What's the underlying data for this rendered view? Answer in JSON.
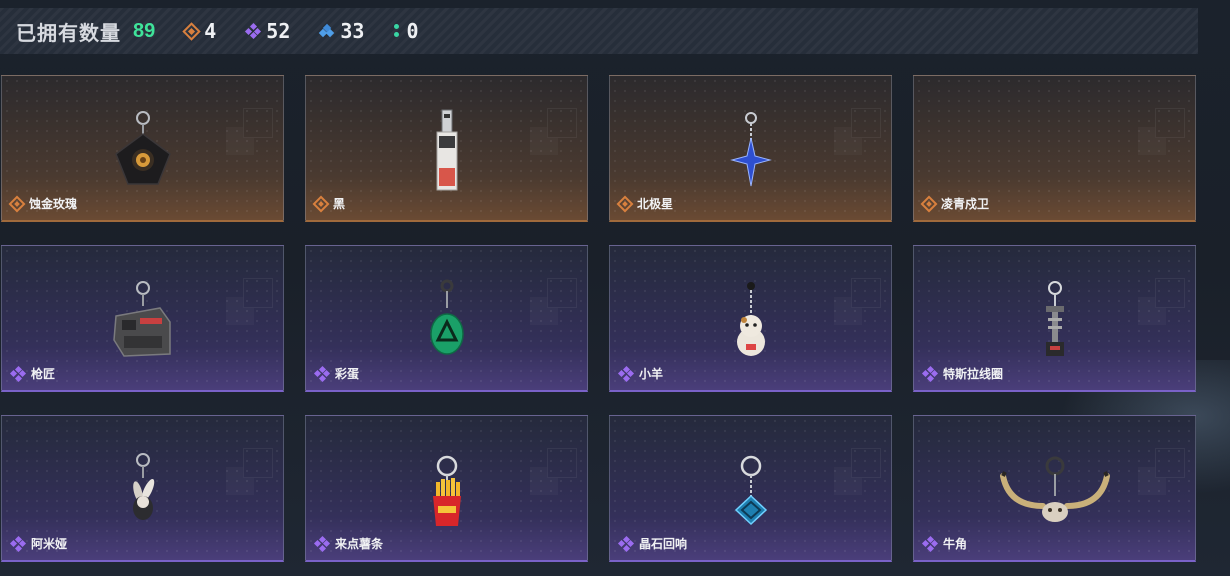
{
  "header": {
    "owned_label": "已拥有数量",
    "owned_count": "89",
    "stats": [
      {
        "rarity": "orange",
        "icon": "orange-diamond-icon",
        "value": "4"
      },
      {
        "rarity": "purple",
        "icon": "purple-diamond-cluster-icon",
        "value": "52"
      },
      {
        "rarity": "blue",
        "icon": "blue-diamond-cluster-icon",
        "value": "33"
      },
      {
        "rarity": "green",
        "icon": "green-dots-icon",
        "value": "0"
      }
    ]
  },
  "colors": {
    "owned_count": "#3fe39a",
    "orange": "#d8803e",
    "purple": "#9b6cf0",
    "blue": "#4f9ee8",
    "green": "#39d6a4"
  },
  "items": [
    {
      "name": "蚀金玫瑰",
      "rarity": "orange",
      "icon": "golden-rose-charm-icon"
    },
    {
      "name": "黑",
      "rarity": "orange",
      "icon": "tag-charm-icon"
    },
    {
      "name": "北极星",
      "rarity": "orange",
      "icon": "blue-star-charm-icon"
    },
    {
      "name": "凌青戍卫",
      "rarity": "orange",
      "icon": "empty-charm-slot"
    },
    {
      "name": "枪匠",
      "rarity": "purple",
      "icon": "gunsmith-box-charm-icon"
    },
    {
      "name": "彩蛋",
      "rarity": "purple",
      "icon": "green-egg-charm-icon"
    },
    {
      "name": "小羊",
      "rarity": "purple",
      "icon": "lucky-cat-charm-icon"
    },
    {
      "name": "特斯拉线圈",
      "rarity": "purple",
      "icon": "tesla-coil-charm-icon"
    },
    {
      "name": "阿米娅",
      "rarity": "purple",
      "icon": "bunny-figure-charm-icon"
    },
    {
      "name": "来点薯条",
      "rarity": "purple",
      "icon": "fries-charm-icon"
    },
    {
      "name": "晶石回响",
      "rarity": "purple",
      "icon": "crystal-cube-charm-icon"
    },
    {
      "name": "牛角",
      "rarity": "purple",
      "icon": "bull-horns-charm-icon"
    }
  ]
}
